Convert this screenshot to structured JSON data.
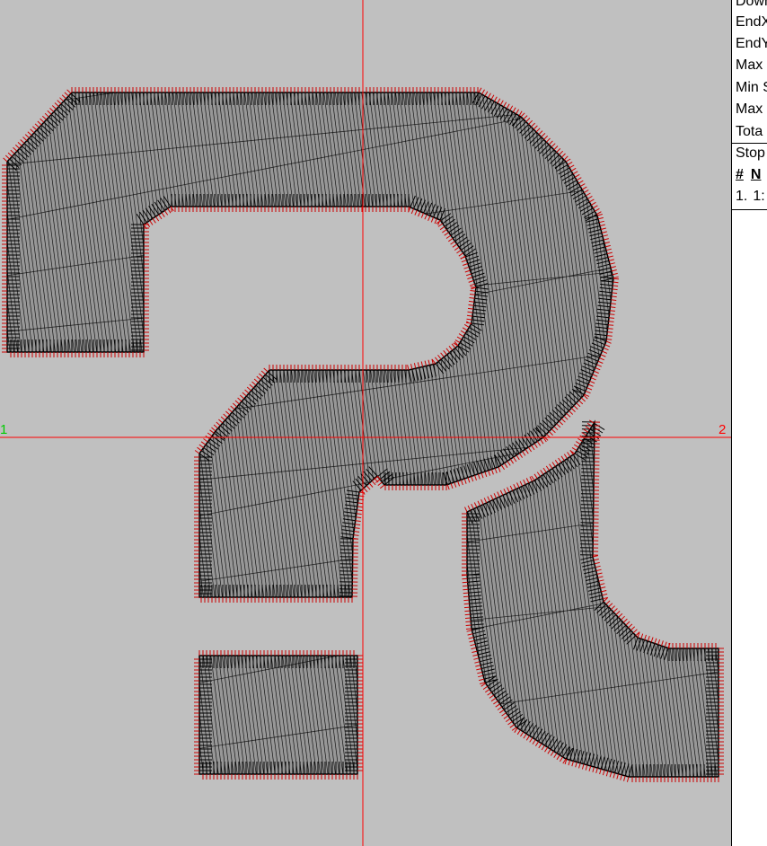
{
  "canvas": {
    "background": "#c0c0c0",
    "crosshair_color": "#ff0000",
    "stitch_color": "#000000",
    "needle_color": "#cc0000",
    "marker_left": "1",
    "marker_left_color": "#00cc00",
    "marker_right": "2",
    "marker_right_color": "#ff0000"
  },
  "stats_panel": {
    "rows": [
      "Down",
      "EndX",
      "EndY",
      "Max",
      "Min S",
      "Max",
      "Tota"
    ],
    "stops_label": "Stop",
    "stops_columns": [
      "#",
      "N"
    ],
    "stops_rows": [
      [
        "1.",
        "1:"
      ]
    ]
  }
}
